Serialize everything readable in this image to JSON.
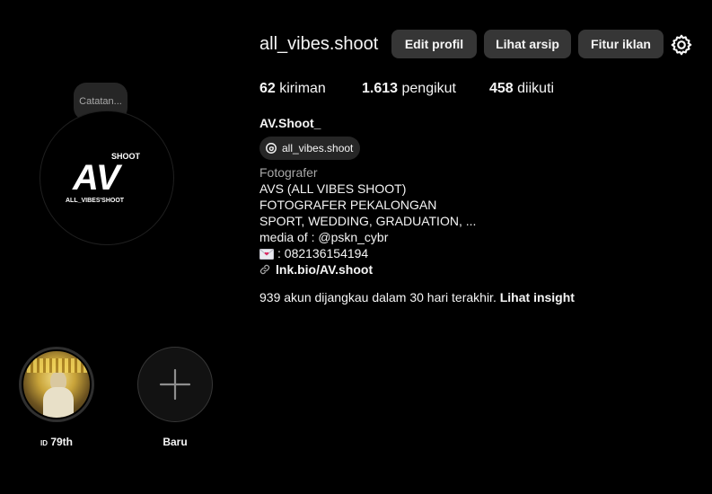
{
  "note": {
    "text": "Catatan..."
  },
  "avatar": {
    "logo_top": "SHOOT",
    "logo_main": "AV",
    "logo_bottom": "ALL_VIBES'SHOOT"
  },
  "profile": {
    "username": "all_vibes.shoot",
    "buttons": {
      "edit": "Edit profil",
      "archive": "Lihat arsip",
      "ads": "Fitur iklan"
    },
    "stats": {
      "posts_count": "62",
      "posts_label": "kiriman",
      "followers_count": "1.613",
      "followers_label": "pengikut",
      "following_count": "458",
      "following_label": "diikuti"
    },
    "full_name": "AV.Shoot_",
    "threads_handle": "all_vibes.shoot",
    "category": "Fotografer",
    "bio": [
      "AVS (ALL VIBES SHOOT)",
      "FOTOGRAFER PEKALONGAN",
      "SPORT, WEDDING, GRADUATION, ...",
      "media of : @pskn_cybr",
      ": 082136154194"
    ],
    "link": "lnk.bio/AV.shoot",
    "insight_text": "939 akun dijangkau dalam 30 hari terakhir.",
    "insight_link": "Lihat insight"
  },
  "highlights": [
    {
      "label": "79th",
      "label_prefix": "ID"
    },
    {
      "label": "Baru"
    }
  ]
}
